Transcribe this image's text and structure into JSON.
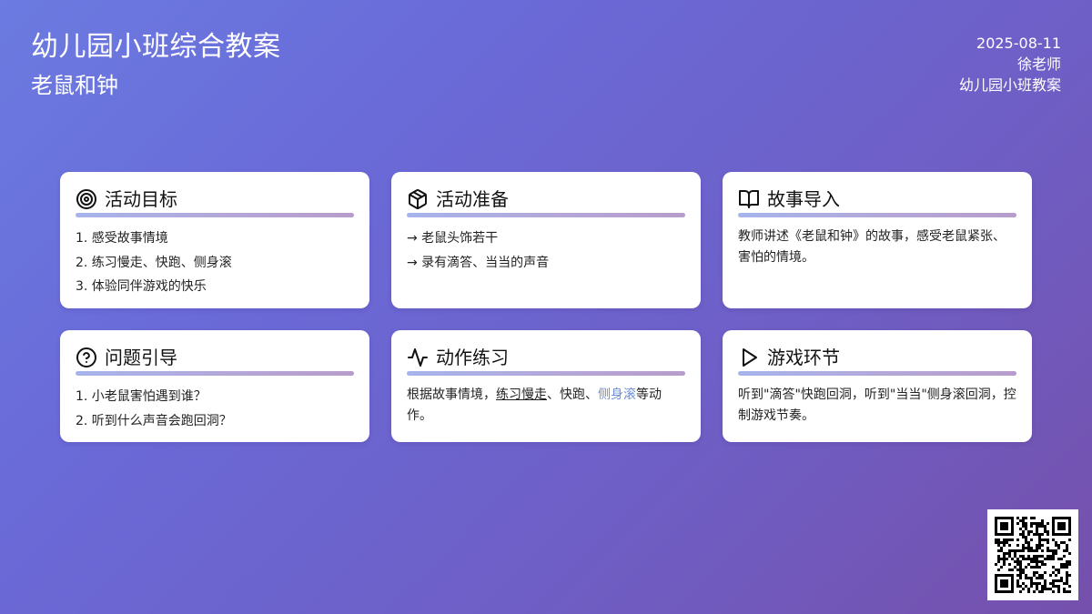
{
  "header": {
    "title": "幼儿园小班综合教案",
    "subtitle": "老鼠和钟"
  },
  "meta": {
    "date": "2025-08-11",
    "teacher": "徐老师",
    "category": "幼儿园小班教案"
  },
  "cards": {
    "goals": {
      "icon": "target-icon",
      "title": "活动目标",
      "items": [
        "1. 感受故事情境",
        "2. 练习慢走、快跑、侧身滚",
        "3. 体验同伴游戏的快乐"
      ]
    },
    "prep": {
      "icon": "box-icon",
      "title": "活动准备",
      "items": [
        "→ 老鼠头饰若干",
        "→ 录有滴答、当当的声音"
      ]
    },
    "story": {
      "icon": "book-open-icon",
      "title": "故事导入",
      "text": "教师讲述《老鼠和钟》的故事，感受老鼠紧张、害怕的情境。"
    },
    "questions": {
      "icon": "help-circle-icon",
      "title": "问题引导",
      "items": [
        "1. 小老鼠害怕遇到谁？",
        "2. 听到什么声音会跑回洞？"
      ]
    },
    "practice": {
      "icon": "activity-icon",
      "title": "动作练习",
      "text_before": "根据故事情境，",
      "underlined": "练习慢走",
      "text_middle": "、快跑、",
      "highlighted": "侧身滚",
      "text_after": "等动作。"
    },
    "game": {
      "icon": "play-icon",
      "title": "游戏环节",
      "text": "听到\"滴答\"快跑回洞，听到\"当当\"侧身滚回洞，控制游戏节奏。"
    }
  },
  "colors": {
    "gradient_start": "#6b7be0",
    "gradient_end": "#7550ac",
    "card_bg": "#ffffff",
    "accent_blue": "#6a8ed8"
  },
  "qr_code": {
    "icon": "qr-code-icon"
  }
}
